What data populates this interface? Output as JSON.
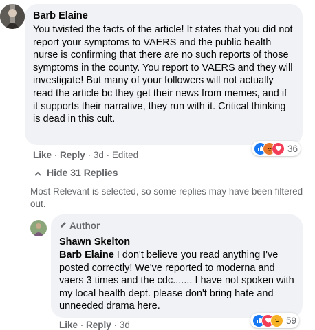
{
  "comment": {
    "author": "Barb Elaine",
    "text": "You twisted the facts of the article! It states that you did not report your symptoms to VAERS and the public health nurse is confirming that there are no such reports of those symptoms in the county. You report to VAERS and they will investigate! But many of your followers will not actually read the article bc they get their news from memes, and if it supports their narrative, they run with it. Critical thinking is dead in this cult.",
    "like_label": "Like",
    "reply_label": "Reply",
    "sep": "·",
    "age": "3d",
    "edited": "Edited",
    "reaction_count": "36",
    "reactions": [
      "like-icon",
      "angry-icon",
      "love-icon"
    ]
  },
  "replies_toggle": {
    "label": "Hide 31 Replies",
    "icon": "chevron-up-icon"
  },
  "filter_notice": "Most Relevant is selected, so some replies may have been filtered out.",
  "reply": {
    "badge": "Author",
    "badge_icon": "pencil-icon",
    "author": "Shawn Skelton",
    "mention": "Barb Elaine",
    "text": " I don't believe you read anything I've posted correctly! We've reported to moderna and vaers 3 times and the cdc....... I have not spoken with my local health dept. please don't bring hate and unneeded drama here.",
    "like_label": "Like",
    "reply_label": "Reply",
    "sep": "·",
    "age": "3d",
    "reaction_count": "59",
    "reactions": [
      "like-icon",
      "love-icon",
      "haha-icon"
    ]
  },
  "colors": {
    "bubble": "#f0f2f5",
    "meta_text": "#65676b",
    "like": "#1877f2",
    "love": "#f33e58",
    "haha": "#f7b125",
    "angry": "#e8772e"
  }
}
